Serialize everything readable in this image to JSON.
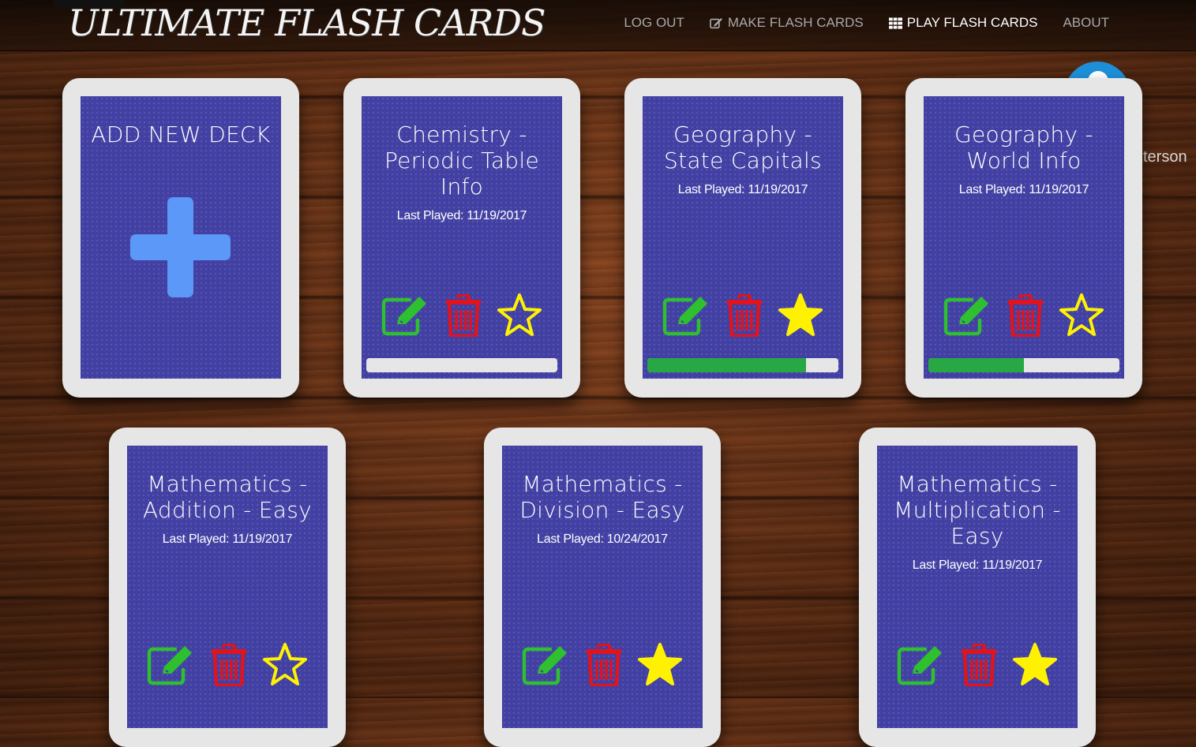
{
  "brand": "ULTIMATE FLASH CARDS",
  "nav": {
    "logout": "LOG OUT",
    "make": "MAKE FLASH CARDS",
    "play": "PLAY FLASH CARDS",
    "about": "ABOUT"
  },
  "user": {
    "name_fragment": "terson"
  },
  "colors": {
    "edit": "#2ec02e",
    "delete": "#e0141c",
    "star": "#fff200",
    "progress": "#28a745",
    "card_face": "#4240a3"
  },
  "add_card": {
    "label": "ADD NEW DECK",
    "icon": "plus-icon"
  },
  "decks": [
    {
      "title": "Chemistry - Periodic Table Info",
      "last_played": "Last Played: 11/19/2017",
      "favorite": false,
      "progress_percent": 0
    },
    {
      "title": "Geography - State Capitals",
      "last_played": "Last Played: 11/19/2017",
      "favorite": true,
      "progress_percent": 83
    },
    {
      "title": "Geography - World Info",
      "last_played": "Last Played: 11/19/2017",
      "favorite": false,
      "progress_percent": 50
    },
    {
      "title": "Mathematics - Addition - Easy",
      "last_played": "Last Played: 11/19/2017",
      "favorite": false
    },
    {
      "title": "Mathematics - Division - Easy",
      "last_played": "Last Played: 10/24/2017",
      "favorite": true
    },
    {
      "title": "Mathematics - Multiplication - Easy",
      "last_played": "Last Played: 11/19/2017",
      "favorite": true
    }
  ]
}
